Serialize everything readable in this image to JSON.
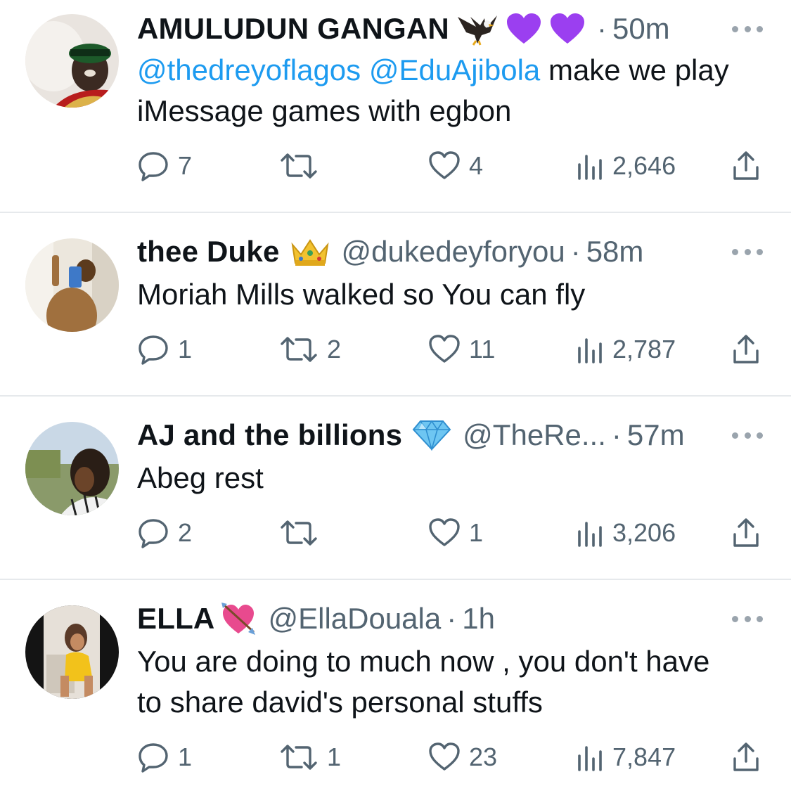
{
  "colors": {
    "accent": "#1d9bf0",
    "secondary": "#536471",
    "text": "#0f1419",
    "divider": "#e6e9ec"
  },
  "tweets": [
    {
      "name": "AMULUDUN GANGAN",
      "badges": [
        "eagle-emoji",
        "purple-heart-emoji",
        "purple-heart-emoji"
      ],
      "handle": "",
      "dot": "·",
      "time": "50m",
      "mentions": [
        "@thedreyoflagos",
        "@EduAjibola"
      ],
      "text_after_mentions": " make we play iMessage games with egbon",
      "replies": "7",
      "retweets": "",
      "likes": "4",
      "views": "2,646"
    },
    {
      "name": "thee Duke",
      "badges": [
        "crown-emoji"
      ],
      "handle": "@dukedeyforyou",
      "dot": "·",
      "time": "58m",
      "text": "Moriah Mills walked so You can fly",
      "replies": "1",
      "retweets": "2",
      "likes": "11",
      "views": "2,787"
    },
    {
      "name": "AJ and the billions",
      "badges": [
        "gem-emoji"
      ],
      "handle": "@TheRe...",
      "dot": "·",
      "time": "57m",
      "text": "Abeg rest",
      "replies": "2",
      "retweets": "",
      "likes": "1",
      "views": "3,206"
    },
    {
      "name": "ELLA",
      "badges": [
        "heart-with-arrow-emoji"
      ],
      "handle": "@EllaDouala",
      "dot": "·",
      "time": "1h",
      "text": "You are doing to much now , you don't have to share david's personal stuffs",
      "replies": "1",
      "retweets": "1",
      "likes": "23",
      "views": "7,847"
    }
  ]
}
